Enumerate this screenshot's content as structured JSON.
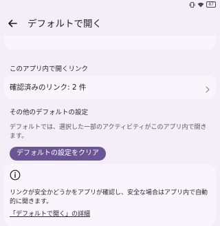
{
  "status_bar": {
    "battery_level": "87",
    "icons": [
      "vibrate-icon",
      "wifi-icon",
      "battery-icon"
    ]
  },
  "app_bar": {
    "back_icon": "arrow-left-icon",
    "title": "デフォルトで開く"
  },
  "sections": {
    "links_in_app": {
      "header": "このアプリ内で開くリンク",
      "verified_links": "確認済みのリンク: 2 件",
      "chevron_icon": "chevron-right-icon"
    },
    "other_defaults": {
      "header": "その他のデフォルトの設定",
      "description": "デフォルトでは、選択した一部のアクティビティがこのアプリ内で開きます。",
      "clear_button": "デフォルトの設定をクリア"
    }
  },
  "info_card": {
    "icon": "info-icon",
    "text": "リンクが安全かどうかをアプリが確認し、安全な場合はアプリ内で自動的に開きます。",
    "link": "「デフォルトで開く」の詳細"
  },
  "colors": {
    "background": "#f4eef9",
    "card": "#f9f5fc",
    "accent_button": "#6b5695"
  }
}
